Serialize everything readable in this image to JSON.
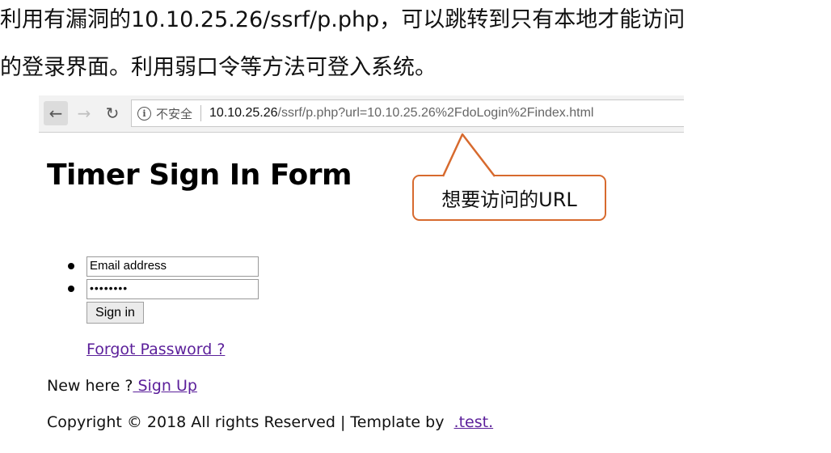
{
  "caption": {
    "line1": "利用有漏洞的10.10.25.26/ssrf/p.php，可以跳转到只有本地才能访问",
    "line2": "的登录界面。利用弱口令等方法可登入系统。"
  },
  "browser": {
    "back_icon": "←",
    "forward_icon": "→",
    "reload_icon": "↻",
    "info_icon": "i",
    "security_label": "不安全",
    "url_host": "10.10.25.26",
    "url_path": "/ssrf/p.php?url=10.10.25.26%2FdoLogin%2Findex.html"
  },
  "page": {
    "title": "Timer Sign In Form",
    "email_value": "Email address",
    "password_value": "••••••••",
    "signin_label": "Sign in",
    "forgot_label": "Forgot Password ?",
    "new_here_text": "New here ?",
    "signup_label": " Sign Up",
    "copyright_text": "Copyright © 2018 All rights Reserved | Template by",
    "template_link": ".test."
  },
  "callout": {
    "text": "想要访问的URL",
    "border_color": "#d76a2e"
  },
  "colors": {
    "link": "#5b1f9a"
  }
}
